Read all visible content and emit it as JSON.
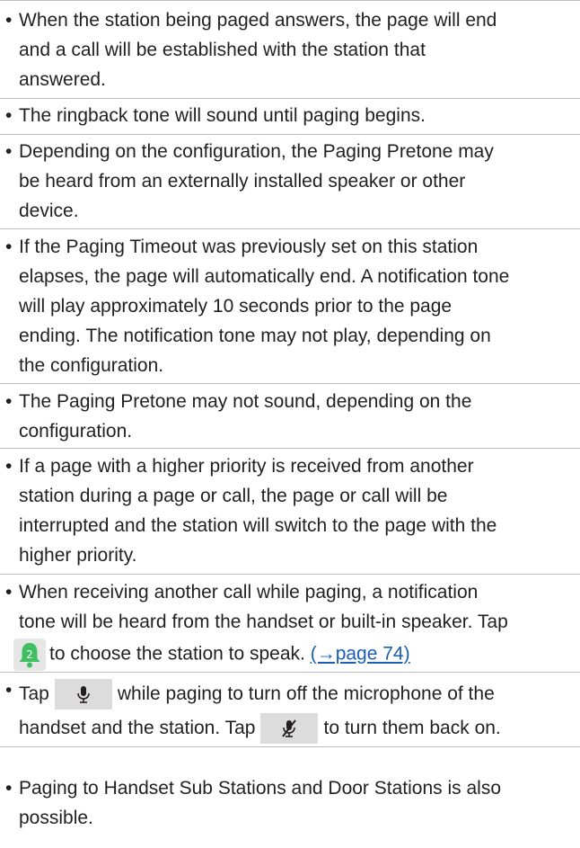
{
  "notes": [
    {
      "text": "When the station being paged answers, the page will end\nand a call will be established with the station that\nanswered."
    },
    {
      "text": "The ringback tone will sound until paging begins."
    },
    {
      "text": "Depending on the configuration, the Paging Pretone may\nbe heard from an externally installed speaker or other\ndevice."
    },
    {
      "text": "If the Paging Timeout was previously set on this station\nelapses, the page will automatically end. A notification tone\nwill play approximately 10 seconds prior to the page\nending. The notification tone may not play, depending on\nthe configuration."
    },
    {
      "text": "The Paging Pretone may not sound, depending on the\nconfiguration."
    },
    {
      "text": "If a page with a higher priority is received from another\nstation during a page or call, the page or call will be\ninterrupted and the station will switch to the page with the\nhigher priority."
    },
    {
      "line1": "When receiving another call while paging, a notification",
      "line2": "tone will be heard from the handset or built-in speaker. Tap",
      "line3": "to choose the station to speak.",
      "link": "(→page 74)",
      "badge": "2",
      "icon": "incoming-call-bell-icon"
    },
    {
      "tap1": "Tap",
      "after_mic": "while paging to turn off the microphone of the",
      "line2": "handset and the station. Tap",
      "after_mute": "to turn them back on.",
      "icon_on": "microphone-icon",
      "icon_off": "microphone-mute-icon"
    },
    {
      "text": "Paging to Handset Sub Stations and Door Stations is also\npossible."
    }
  ],
  "bullet": "•",
  "colors": {
    "text": "#231f20",
    "separator": "#bdbdbd",
    "link": "#1a5fb4",
    "button_bg": "#dcdcdc",
    "bell_green": "#3fbf5f"
  }
}
